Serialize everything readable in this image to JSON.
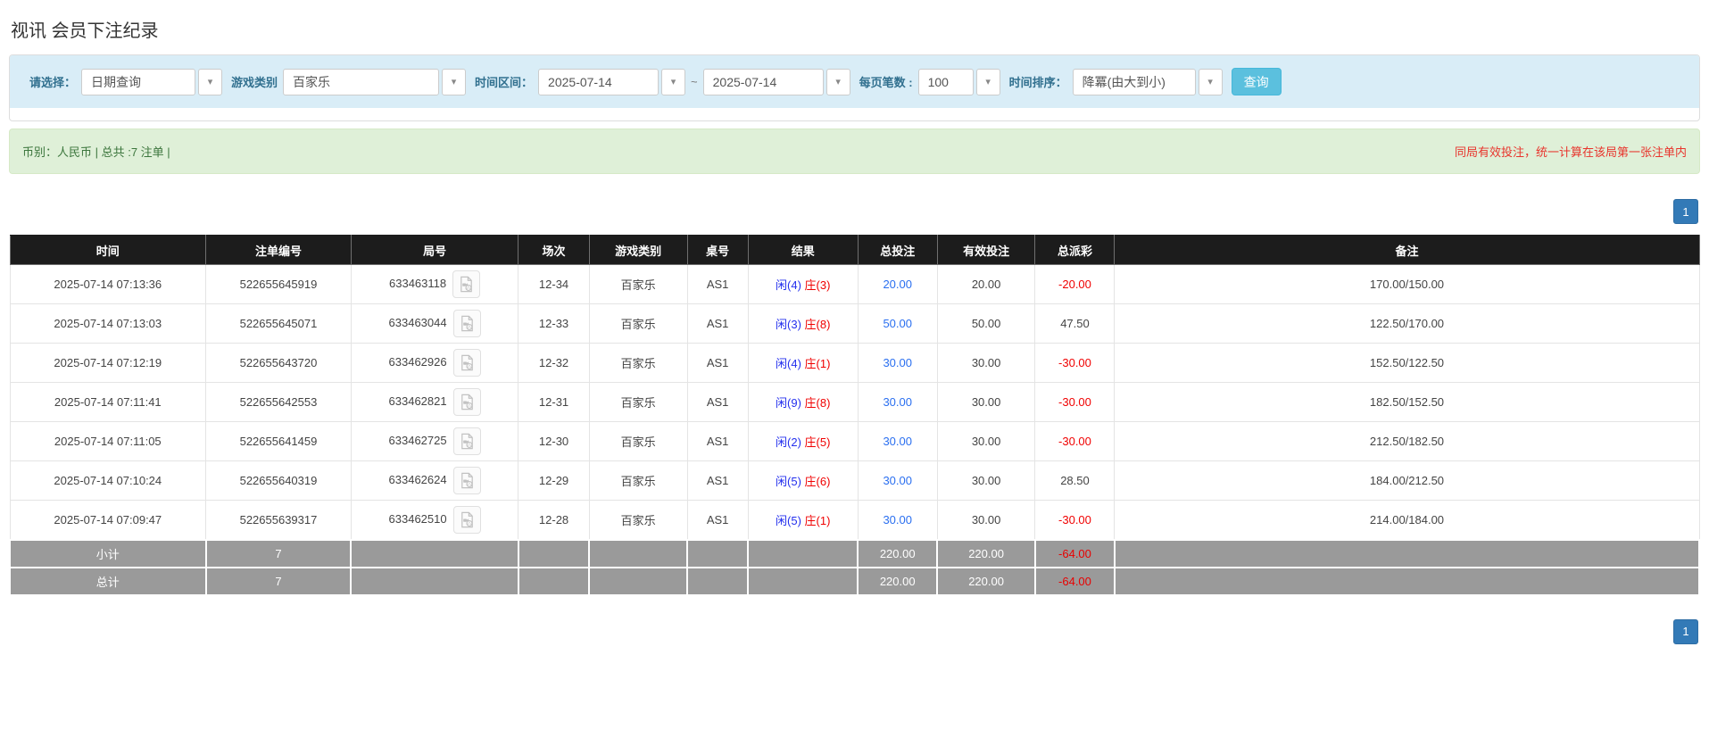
{
  "page": {
    "title": "视讯 会员下注纪录"
  },
  "filters": {
    "select_label": "请选择：",
    "select_value": "日期查询",
    "game_label": "游戏类别",
    "game_value": "百家乐",
    "range_label": "时间区间：",
    "date_from": "2025-07-14",
    "range_separator": "~",
    "date_to": "2025-07-14",
    "page_size_label": "每页笔数 :",
    "page_size_value": "100",
    "sort_label": "时间排序：",
    "sort_value": "降冪(由大到小)",
    "search_button": "查询"
  },
  "summary_bar": {
    "left": "币别：人民币 | 总共 :7 注单 |",
    "right": "同局有效投注，统一计算在该局第一张注单内"
  },
  "pagination": {
    "page": "1"
  },
  "icons": {
    "dropdown_caret": "▾",
    "video_replay": "video-replay-icon"
  },
  "colors": {
    "search_button": "#5bc0de",
    "pagination_blue": "#337ab7",
    "player_blue": "#2430ee",
    "banker_red": "#f00202",
    "bet_link_blue": "#2a6ff0",
    "negative_red": "#f00202",
    "warning_red": "#e8342c"
  },
  "table": {
    "headers": [
      "时间",
      "注单编号",
      "局号",
      "场次",
      "游戏类别",
      "桌号",
      "结果",
      "总投注",
      "有效投注",
      "总派彩",
      "备注"
    ],
    "rows": [
      {
        "time": "2025-07-14 07:13:36",
        "bet_id": "522655645919",
        "round_id": "633463118",
        "session": "12-34",
        "game": "百家乐",
        "table_no": "AS1",
        "result_player": "闲(4)",
        "result_banker": "庄(3)",
        "total_bet": "20.00",
        "valid_bet": "20.00",
        "payout": "-20.00",
        "note": "170.00/150.00"
      },
      {
        "time": "2025-07-14 07:13:03",
        "bet_id": "522655645071",
        "round_id": "633463044",
        "session": "12-33",
        "game": "百家乐",
        "table_no": "AS1",
        "result_player": "闲(3)",
        "result_banker": "庄(8)",
        "total_bet": "50.00",
        "valid_bet": "50.00",
        "payout": "47.50",
        "note": "122.50/170.00"
      },
      {
        "time": "2025-07-14 07:12:19",
        "bet_id": "522655643720",
        "round_id": "633462926",
        "session": "12-32",
        "game": "百家乐",
        "table_no": "AS1",
        "result_player": "闲(4)",
        "result_banker": "庄(1)",
        "total_bet": "30.00",
        "valid_bet": "30.00",
        "payout": "-30.00",
        "note": "152.50/122.50"
      },
      {
        "time": "2025-07-14 07:11:41",
        "bet_id": "522655642553",
        "round_id": "633462821",
        "session": "12-31",
        "game": "百家乐",
        "table_no": "AS1",
        "result_player": "闲(9)",
        "result_banker": "庄(8)",
        "total_bet": "30.00",
        "valid_bet": "30.00",
        "payout": "-30.00",
        "note": "182.50/152.50"
      },
      {
        "time": "2025-07-14 07:11:05",
        "bet_id": "522655641459",
        "round_id": "633462725",
        "session": "12-30",
        "game": "百家乐",
        "table_no": "AS1",
        "result_player": "闲(2)",
        "result_banker": "庄(5)",
        "total_bet": "30.00",
        "valid_bet": "30.00",
        "payout": "-30.00",
        "note": "212.50/182.50"
      },
      {
        "time": "2025-07-14 07:10:24",
        "bet_id": "522655640319",
        "round_id": "633462624",
        "session": "12-29",
        "game": "百家乐",
        "table_no": "AS1",
        "result_player": "闲(5)",
        "result_banker": "庄(6)",
        "total_bet": "30.00",
        "valid_bet": "30.00",
        "payout": "28.50",
        "note": "184.00/212.50"
      },
      {
        "time": "2025-07-14 07:09:47",
        "bet_id": "522655639317",
        "round_id": "633462510",
        "session": "12-28",
        "game": "百家乐",
        "table_no": "AS1",
        "result_player": "闲(5)",
        "result_banker": "庄(1)",
        "total_bet": "30.00",
        "valid_bet": "30.00",
        "payout": "-30.00",
        "note": "214.00/184.00"
      }
    ],
    "subtotal": {
      "label": "小计",
      "count": "7",
      "total_bet": "220.00",
      "valid_bet": "220.00",
      "payout": "-64.00"
    },
    "total": {
      "label": "总计",
      "count": "7",
      "total_bet": "220.00",
      "valid_bet": "220.00",
      "payout": "-64.00"
    }
  }
}
